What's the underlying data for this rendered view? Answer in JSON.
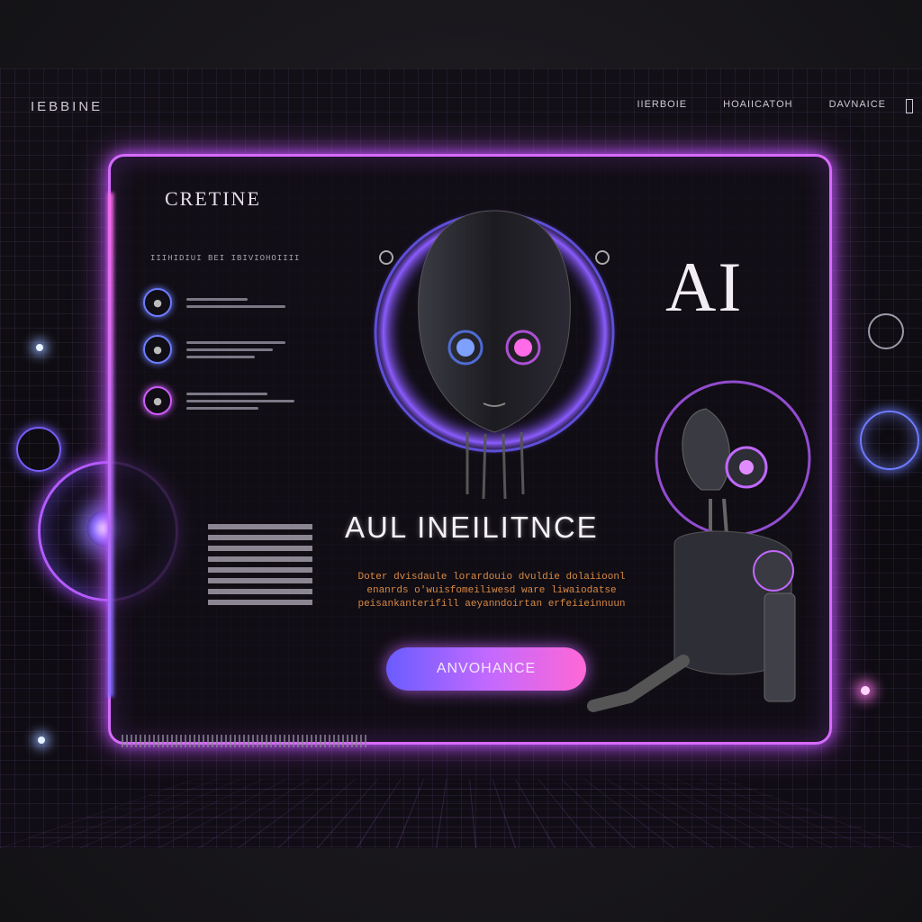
{
  "nav": {
    "logo": "IEBBINE",
    "items": [
      "IIERBOIE",
      "HOAIICATOH",
      "DAVNAICE"
    ]
  },
  "panel": {
    "brand": "CRETINE",
    "tagline": "IIIHIDIUI BEI IBIVIOHOIIII",
    "ai_title": "AI",
    "hero_title": "AUL INEILITNCE",
    "description": "Doter dvisdaule lorardouio dvuldie dolaiioonl enanrds o'wuisfomeiliwesd ware liwaiodatse peisankanterifill aeyanndoirtan erfeiieinnuun",
    "cta_label": "ANVOHANCE"
  },
  "colors": {
    "accent_pink": "#d76bff",
    "accent_blue": "#6a5cff",
    "cta_gradient_end": "#ff68d6"
  },
  "icons": {
    "feature_1": "circle-dot-icon",
    "feature_2": "circle-dot-icon",
    "feature_3": "circle-dot-icon"
  }
}
